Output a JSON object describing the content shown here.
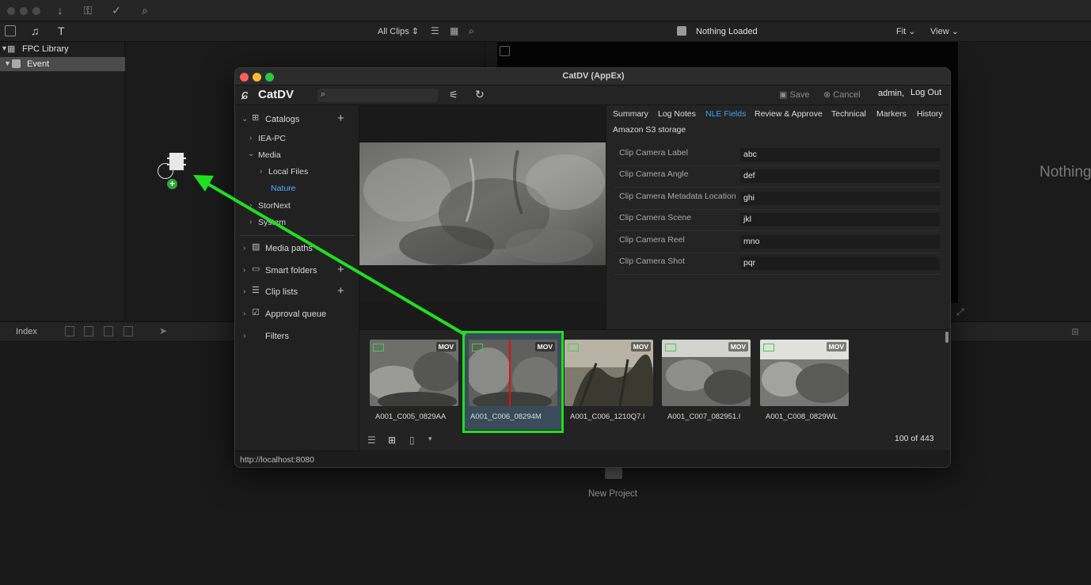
{
  "fcp": {
    "browser_filter": "All Clips",
    "viewer_title": "Nothing Loaded",
    "fit_label": "Fit",
    "view_label": "View",
    "library_name": "FPC Library",
    "event_name": "Event",
    "index_label": "Index",
    "viewer_overlay_text": "Nothing",
    "new_project_label": "New Project"
  },
  "catdv": {
    "window_title": "CatDV (AppEx)",
    "logo_text": "CatDV",
    "search_placeholder": "",
    "save_label": "Save",
    "cancel_label": "Cancel",
    "user_name": "admin",
    "user_separator": ",",
    "logout_label": "Log Out",
    "status_url": "http://localhost:8080",
    "sidebar": {
      "catalogs_label": "Catalogs",
      "tree": [
        {
          "label": "IEA-PC"
        },
        {
          "label": "Media"
        },
        {
          "label": "Local Files"
        },
        {
          "label": "Nature"
        },
        {
          "label": "StorNext"
        },
        {
          "label": "System"
        }
      ],
      "sections": [
        {
          "label": "Media paths"
        },
        {
          "label": "Smart folders"
        },
        {
          "label": "Clip lists"
        },
        {
          "label": "Approval queue"
        },
        {
          "label": "Filters"
        }
      ]
    },
    "tabs": [
      {
        "label": "Summary"
      },
      {
        "label": "Log Notes"
      },
      {
        "label": "NLE Fields"
      },
      {
        "label": "Review & Approve"
      },
      {
        "label": "Technical"
      },
      {
        "label": "Markers"
      },
      {
        "label": "History"
      },
      {
        "label": "Amazon S3 storage"
      }
    ],
    "active_tab": "NLE Fields",
    "fields": [
      {
        "label": "Clip Camera Label",
        "value": "abc"
      },
      {
        "label": "Clip Camera Angle",
        "value": "def"
      },
      {
        "label": "Clip Camera Metadata Location",
        "value": "ghi"
      },
      {
        "label": "Clip Camera Scene",
        "value": "jkl"
      },
      {
        "label": "Clip Camera Reel",
        "value": "mno"
      },
      {
        "label": "Clip Camera Shot",
        "value": "pqr"
      }
    ],
    "clips": [
      {
        "name": "A001_C005_0829AA",
        "badge": "MOV"
      },
      {
        "name": "A001_C006_08294M",
        "badge": "MOV"
      },
      {
        "name": "A001_C006_1210Q7.I",
        "badge": "MOV"
      },
      {
        "name": "A001_C007_082951.I",
        "badge": "MOV"
      },
      {
        "name": "A001_C008_0829WL",
        "badge": "MOV"
      }
    ],
    "selected_clip": "A001_C006_08294M",
    "clip_count": "100 of 443"
  },
  "colors": {
    "highlight_green": "#22dd22",
    "active_tab_blue": "#3fa3f0",
    "tree_selected_blue": "#55b0ff"
  }
}
